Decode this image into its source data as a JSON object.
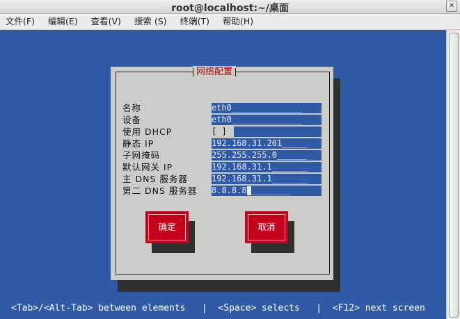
{
  "window": {
    "title": "root@localhost:~/桌面"
  },
  "menu": [
    "文件(F)",
    "编辑(E)",
    "查看(V)",
    "搜索 (S)",
    "终端(T)",
    "帮助(H)"
  ],
  "dialog": {
    "title": "网络配置",
    "rows": [
      {
        "label": "名称",
        "value": "eth0______________"
      },
      {
        "label": "设备",
        "value": "eth0______________"
      },
      {
        "label": "使用 DHCP",
        "value": "[ ]"
      },
      {
        "label": "静态 IP",
        "value": "192.168.31.201_____"
      },
      {
        "label": "子网掩码",
        "value": "255.255.255.0______"
      },
      {
        "label": "默认网关 IP",
        "value": "192.168.31.1_______"
      },
      {
        "label": "主 DNS 服务器",
        "value": "192.168.31.1_______"
      },
      {
        "label": "第二 DNS 服务器",
        "value": "8.8.8.8",
        "trail": "________"
      }
    ],
    "ok_label": "确定",
    "cancel_label": "取消"
  },
  "status_line": "<Tab>/<Alt-Tab> between elements   |  <Space> selects   |  <F12> next screen",
  "colors": {
    "terminal_bg": "#2f5aa6",
    "dialog_bg": "#cdcdc8",
    "button_red": "#c4001c",
    "title_red": "#c00000"
  }
}
